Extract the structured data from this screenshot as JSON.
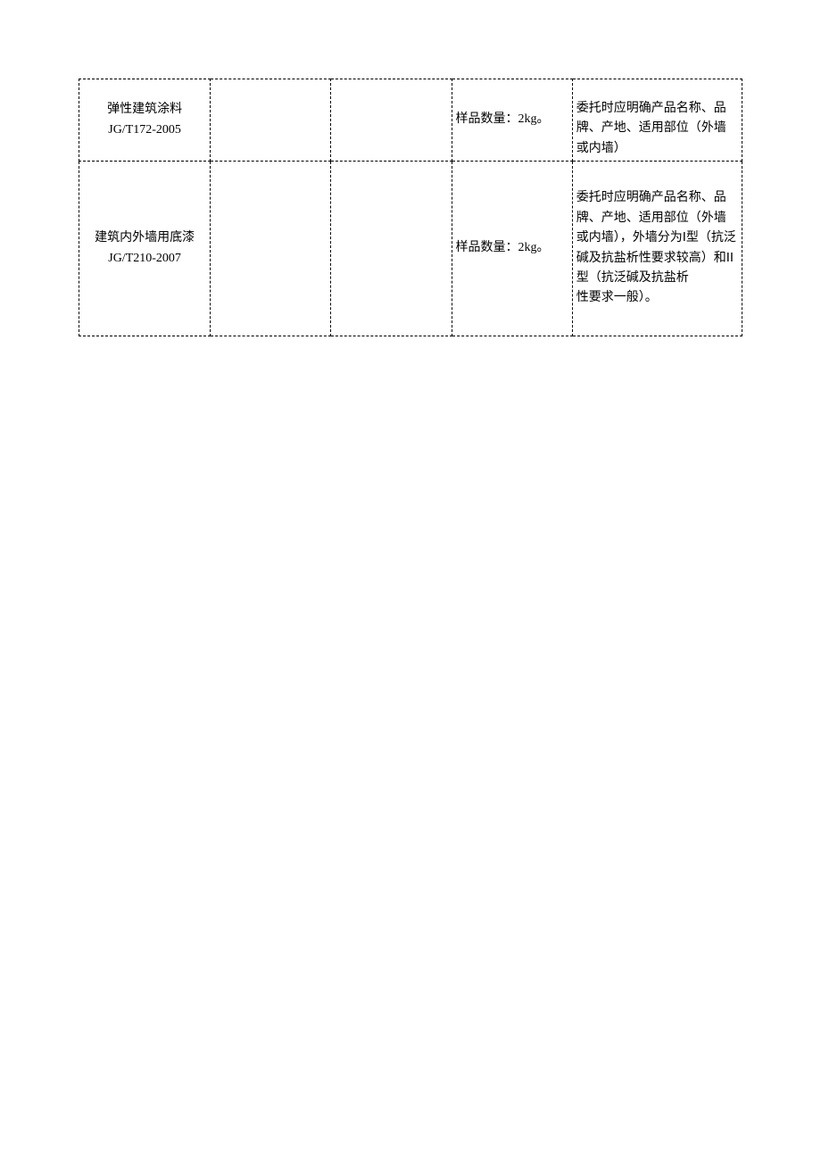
{
  "table": {
    "rows": [
      {
        "name": "弹性建筑涂料\nJG/T172-2005",
        "col2": "",
        "col3": "",
        "sample": "样品数量：2kg。",
        "note": "委托时应明确产品名称、品牌、产地、适用部位（外墙或内墙）"
      },
      {
        "name": "建筑内外墙用底漆\nJG/T210-2007",
        "col2": "",
        "col3": "",
        "sample": "样品数量：2kg。",
        "note": "委托时应明确产品名称、品牌、产地、适用部位（外墙或内墙），外墙分为Ⅰ型（抗泛碱及抗盐析性要求较高）和ⅠⅠ型（抗泛碱及抗盐析\n性要求一般）。"
      }
    ]
  }
}
